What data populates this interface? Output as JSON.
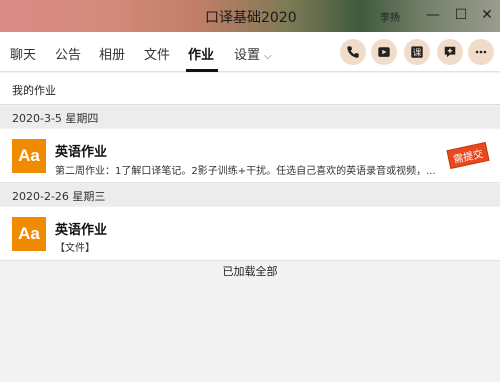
{
  "window": {
    "title": "口译基础2020",
    "user": "李扬",
    "minimize": "—",
    "maximize": "☐",
    "close": "✕"
  },
  "tabs": [
    {
      "label": "聊天"
    },
    {
      "label": "公告"
    },
    {
      "label": "相册"
    },
    {
      "label": "文件"
    },
    {
      "label": "作业"
    },
    {
      "label": "设置"
    }
  ],
  "actions": [
    {
      "icon": "phone-icon"
    },
    {
      "icon": "video-icon"
    },
    {
      "icon": "class-icon",
      "text": "课"
    },
    {
      "icon": "add-message-icon"
    },
    {
      "icon": "more-icon"
    }
  ],
  "subheader": "我的作业",
  "groups": [
    {
      "date": "2020-3-5 星期四",
      "item": {
        "icon_text": "Aa",
        "title": "英语作业",
        "desc": "第二周作业：1了解口译笔记。2影子训练+干扰。任选自己喜欢的英语录音或视频，...",
        "badge": "需提交"
      }
    },
    {
      "date": "2020-2-26 星期三",
      "item": {
        "icon_text": "Aa",
        "title": "英语作业",
        "desc": "【文件】"
      }
    }
  ],
  "footer": "已加载全部",
  "colors": {
    "accent": "#f08a00",
    "badge": "#e8491e",
    "action_bg": "#f0dcc9"
  }
}
